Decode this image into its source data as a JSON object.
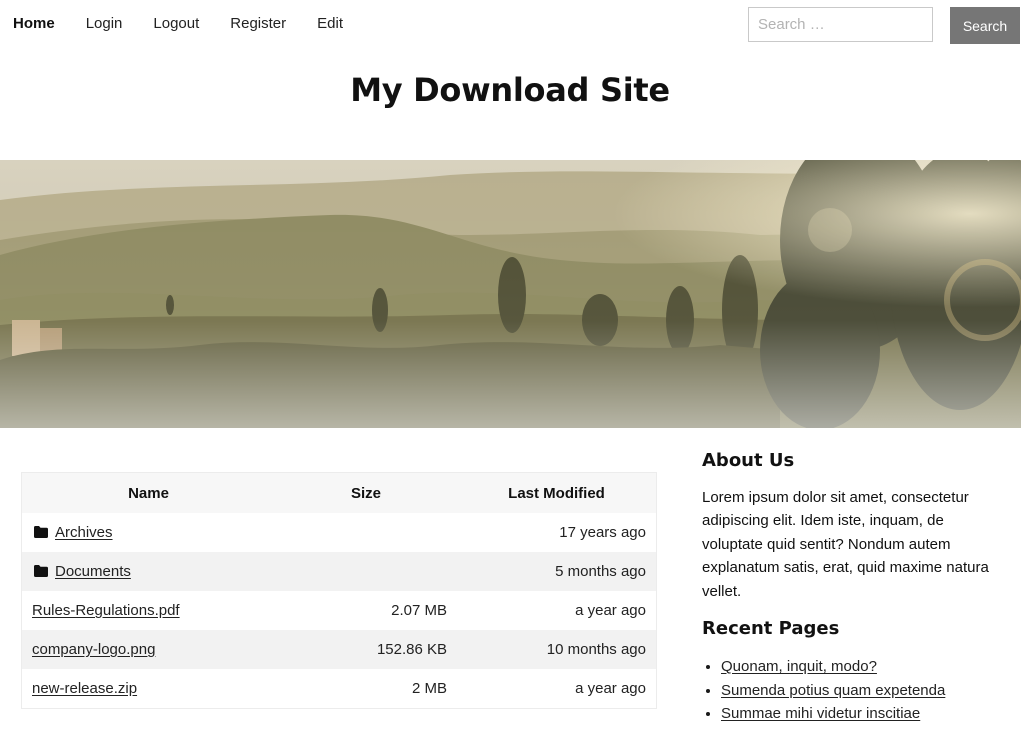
{
  "nav": {
    "items": [
      {
        "label": "Home",
        "active": true
      },
      {
        "label": "Login",
        "active": false
      },
      {
        "label": "Logout",
        "active": false
      },
      {
        "label": "Register",
        "active": false
      },
      {
        "label": "Edit",
        "active": false
      }
    ]
  },
  "search": {
    "placeholder": "Search …",
    "value": "",
    "button_label": "Search"
  },
  "site": {
    "title": "My Download Site"
  },
  "file_table": {
    "columns": [
      "Name",
      "Size",
      "Last Modified"
    ],
    "rows": [
      {
        "name": "Archives",
        "type": "folder",
        "icon": "folder-icon",
        "size": "",
        "modified": "17 years ago"
      },
      {
        "name": "Documents",
        "type": "folder",
        "icon": "folder-icon",
        "size": "",
        "modified": "5 months ago"
      },
      {
        "name": "Rules-Regulations.pdf",
        "type": "file",
        "size": "2.07 MB",
        "modified": "a year ago"
      },
      {
        "name": "company-logo.png",
        "type": "file",
        "size": "152.86 KB",
        "modified": "10 months ago"
      },
      {
        "name": "new-release.zip",
        "type": "file",
        "size": "2 MB",
        "modified": "a year ago"
      }
    ]
  },
  "sidebar": {
    "about": {
      "title": "About Us",
      "text": "Lorem ipsum dolor sit amet, consectetur adipiscing elit. Idem iste, inquam, de voluptate quid sentit? Nondum autem explanatum satis, erat, quid maxime natura vellet."
    },
    "recent": {
      "title": "Recent Pages",
      "items": [
        "Quonam, inquit, modo?",
        "Sumenda potius quam expetenda",
        "Summae mihi videtur inscitiae"
      ]
    }
  },
  "colors": {
    "search_button_bg": "#767676",
    "table_stripe": "#f2f2f2",
    "text": "#222222"
  }
}
